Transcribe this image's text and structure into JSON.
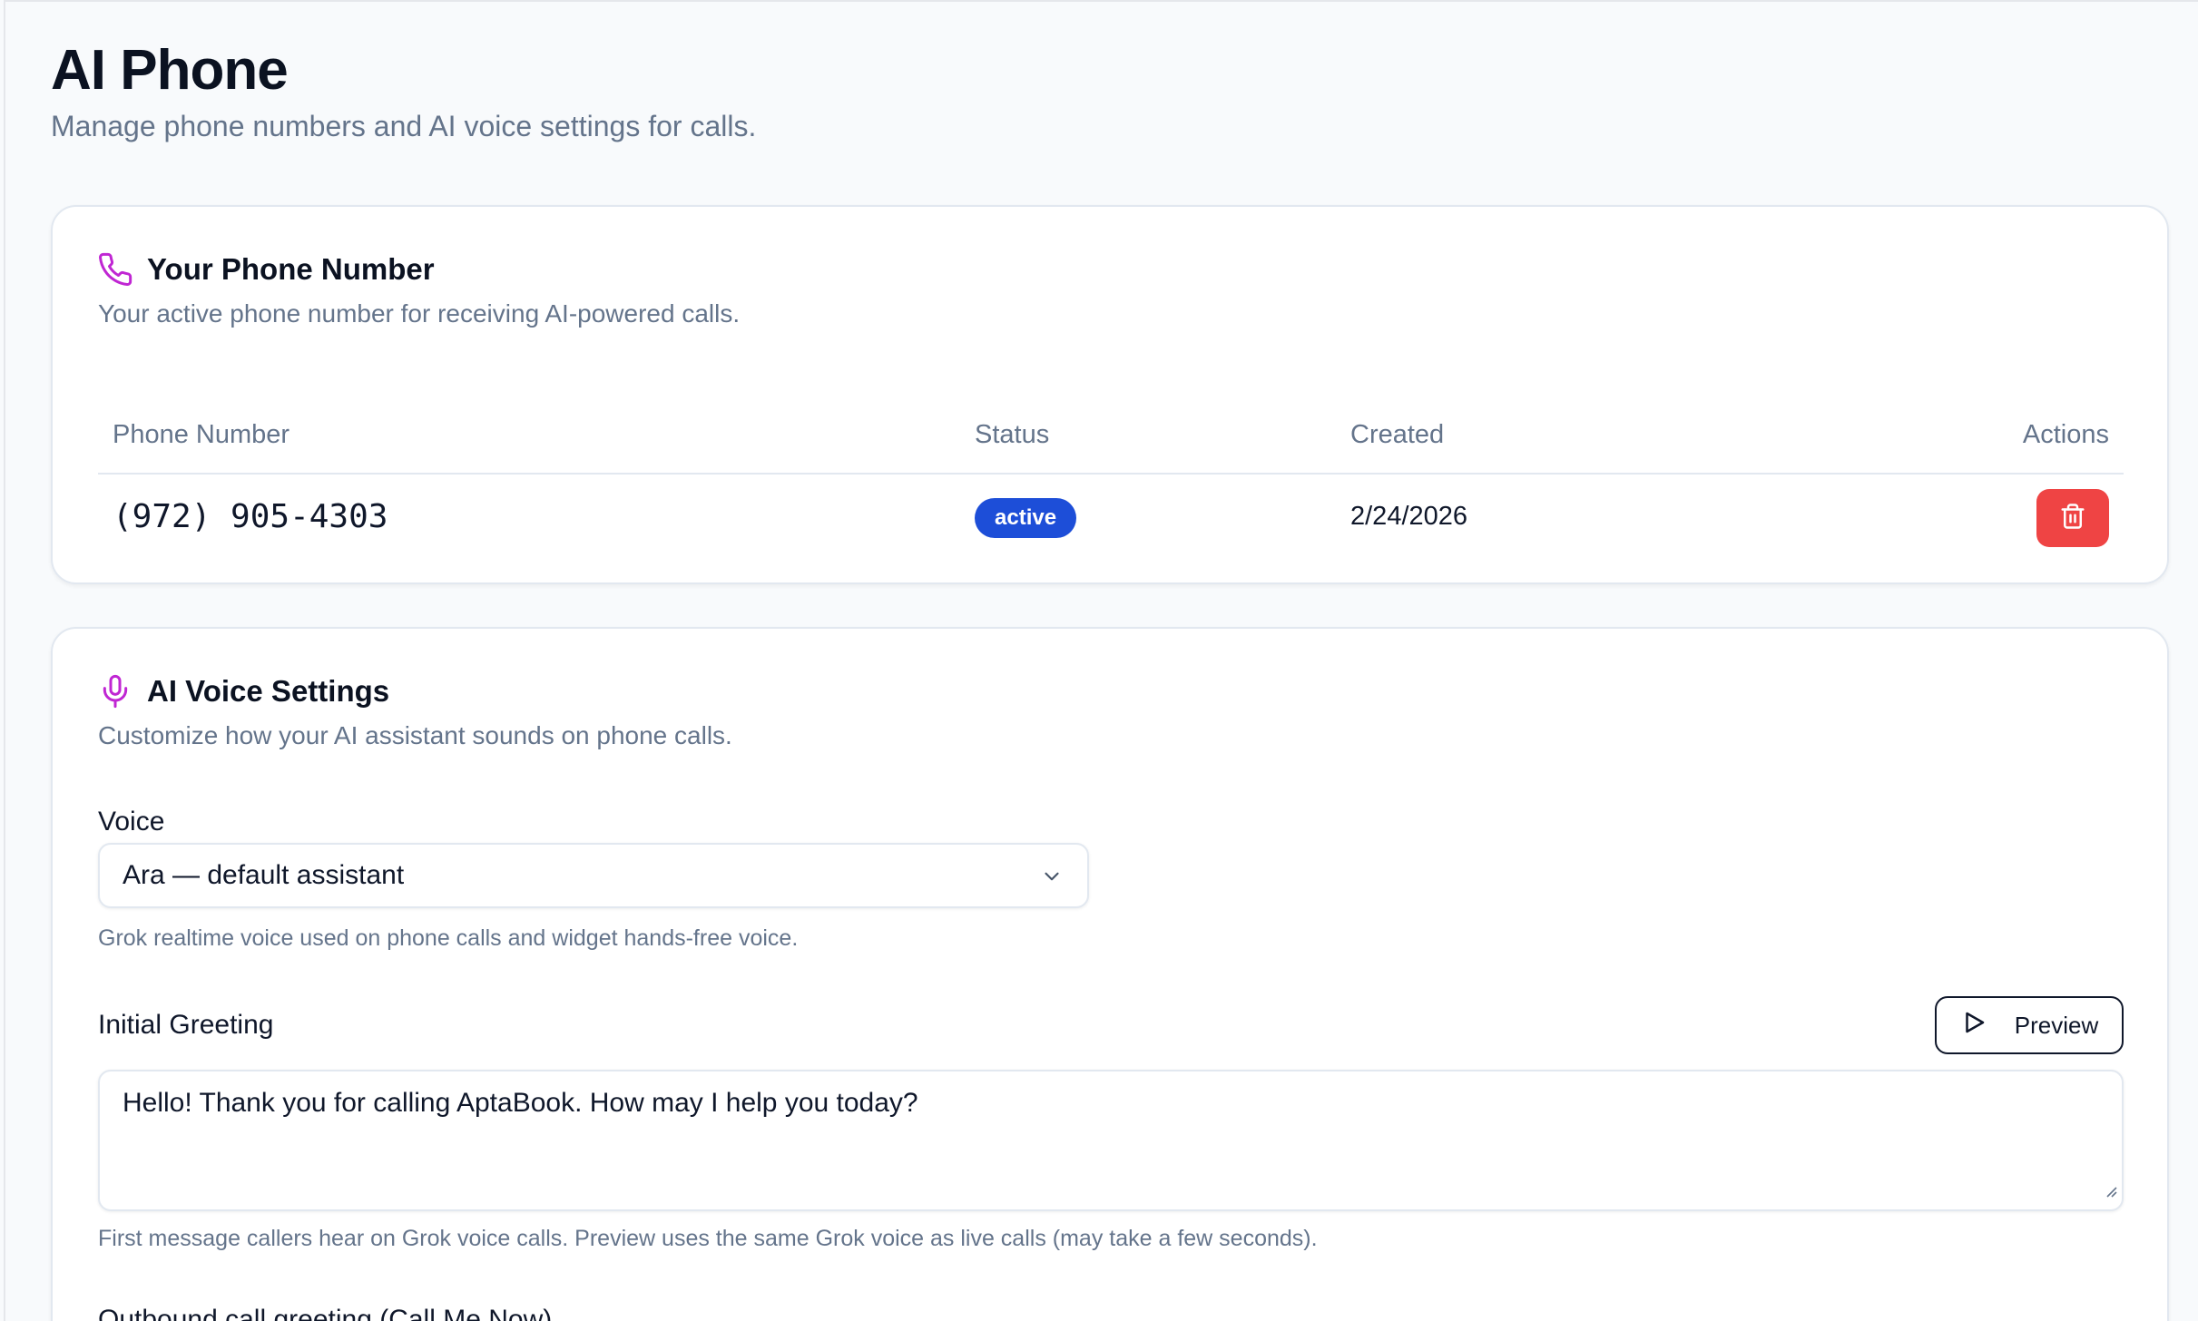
{
  "page": {
    "title": "AI Phone",
    "subtitle": "Manage phone numbers and AI voice settings for calls."
  },
  "phone_card": {
    "title": "Your Phone Number",
    "description": "Your active phone number for receiving AI-powered calls.",
    "icon": "phone-icon",
    "columns": [
      "Phone Number",
      "Status",
      "Created",
      "Actions"
    ],
    "rows": [
      {
        "phone": "(972) 905-4303",
        "status": "active",
        "created": "2/24/2026",
        "action_icon": "trash-icon"
      }
    ]
  },
  "voice_card": {
    "title": "AI Voice Settings",
    "description": "Customize how your AI assistant sounds on phone calls.",
    "icon": "microphone-icon",
    "voice": {
      "label": "Voice",
      "selected": "Ara — default assistant",
      "help": "Grok realtime voice used on phone calls and widget hands-free voice."
    },
    "greeting": {
      "label": "Initial Greeting",
      "preview_label": "Preview",
      "value": "Hello! Thank you for calling AptaBook. How may I help you today?",
      "help": "First message callers hear on Grok voice calls. Preview uses the same Grok voice as live calls (may take a few seconds)."
    },
    "outbound": {
      "label": "Outbound call greeting (Call Me Now)"
    }
  },
  "colors": {
    "accent_icon": "#c026d3",
    "badge_active": "#1d4ed8",
    "danger": "#ef4444"
  }
}
